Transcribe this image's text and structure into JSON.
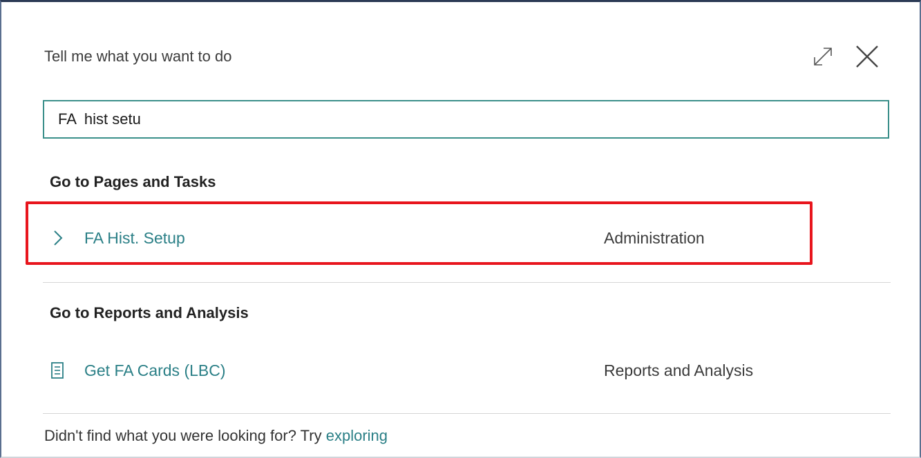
{
  "dialog": {
    "title": "Tell me what you want to do"
  },
  "search": {
    "value": "FA  hist setu",
    "placeholder": ""
  },
  "sections": [
    {
      "heading": "Go to Pages and Tasks",
      "results": [
        {
          "label": "FA Hist. Setup",
          "category": "Administration",
          "icon": "chevron-right-icon"
        }
      ]
    },
    {
      "heading": "Go to Reports and Analysis",
      "results": [
        {
          "label": "Get FA Cards (LBC)",
          "category": "Reports and Analysis",
          "icon": "report-icon"
        }
      ]
    }
  ],
  "footer": {
    "text": "Didn't find what you were looking for? Try",
    "link": "exploring"
  },
  "colors": {
    "accent": "#2a7f86",
    "input_border": "#3a8f8a",
    "highlight": "#e8151d"
  }
}
